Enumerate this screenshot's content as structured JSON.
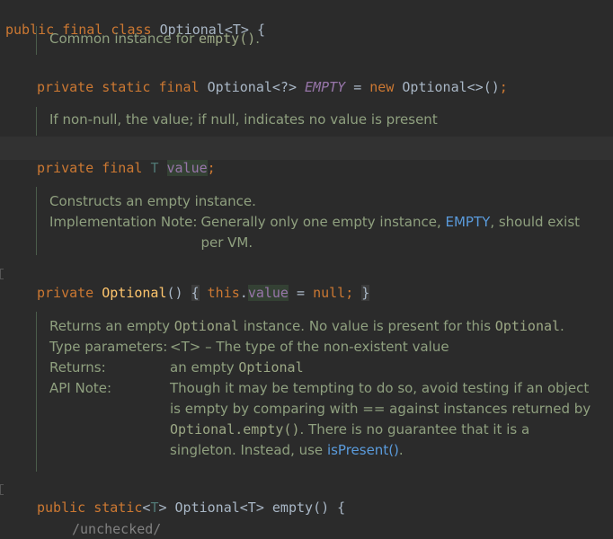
{
  "code": {
    "class_decl": {
      "kw1": "public",
      "kw2": "final",
      "kw3": "class",
      "name": "Optional",
      "type_param": "<T>",
      "brace": " {"
    },
    "empty_field": {
      "kw1": "private",
      "kw2": "static",
      "kw3": "final",
      "type": "Optional<?>",
      "name": "EMPTY",
      "eq": " = ",
      "new_kw": "new",
      "init": "Optional<>()",
      "semi": ";"
    },
    "value_field": {
      "kw1": "private",
      "kw2": "final",
      "type": "T",
      "name": "value",
      "semi": ";"
    },
    "ctor": {
      "kw1": "private",
      "name": "Optional",
      "parens": "()",
      "open": "{",
      "this_kw": "this",
      "dot": ".",
      "field": "value",
      "eq": " = ",
      "null_kw": "null",
      "semi": ";",
      "close": "}"
    },
    "empty_method": {
      "kw1": "public",
      "kw2": "static",
      "type_param_open": "<",
      "type_param": "T",
      "type_param_close": ">",
      "ret_type": "Optional<T>",
      "name": "empty",
      "sig_rest": "() {"
    },
    "cutoff_line": "/unchecked/"
  },
  "docs": {
    "empty_doc": {
      "text": "Common instance for ",
      "code": "empty()",
      "end": "."
    },
    "value_doc": {
      "text": "If non-null, the value; if null, indicates no value is present"
    },
    "ctor_doc": {
      "line1": "Constructs an empty instance.",
      "impl_label": "Implementation Note:",
      "impl_text1": "Generally only one empty instance, ",
      "impl_link": "EMPTY",
      "impl_text2": ", should exist",
      "impl_text3": "per VM."
    },
    "method_doc": {
      "l1a": "Returns an empty ",
      "l1code": "Optional",
      "l1b": " instance. No value is present for this ",
      "l1code2": "Optional",
      "l1c": ".",
      "tp_label": "Type parameters:",
      "tp_text": "<T> – The type of the non-existent value",
      "ret_label": "Returns:",
      "ret_text": "an empty ",
      "ret_code": "Optional",
      "api_label": "API Note:",
      "api1": "Though it may be tempting to do so, avoid testing if an object",
      "api2": "is empty by comparing with == against instances returned by",
      "api3code": "Optional.empty()",
      "api3": ". There is no guarantee that it is a",
      "api4": "singleton. Instead, use ",
      "api4link": "isPresent()",
      "api4end": "."
    }
  },
  "colors": {
    "background": "#2b2b2b",
    "keyword": "#cc7832",
    "field": "#9876aa",
    "method": "#ffc66d",
    "doc_text": "#8fa07f",
    "link": "#5a9bdc"
  }
}
